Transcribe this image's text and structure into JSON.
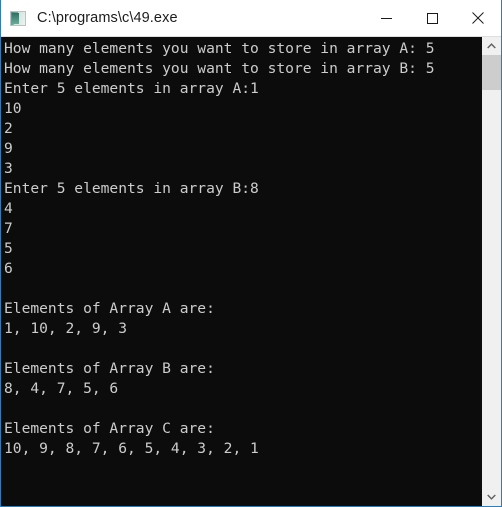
{
  "window": {
    "title": "C:\\programs\\c\\49.exe",
    "icon": "console-app-icon",
    "border_color": "#2e7cb8",
    "controls": [
      {
        "name": "minimize-button",
        "label": "Minimize",
        "glyph": "minimize-icon"
      },
      {
        "name": "maximize-button",
        "label": "Maximize",
        "glyph": "maximize-icon"
      },
      {
        "name": "close-button",
        "label": "Close",
        "glyph": "close-icon"
      }
    ]
  },
  "console": {
    "background_color": "#0c0c0c",
    "text_color": "#cccccc",
    "lines": [
      "How many elements you want to store in array A: 5",
      "How many elements you want to store in array B: 5",
      "Enter 5 elements in array A:1",
      "10",
      "2",
      "9",
      "3",
      "Enter 5 elements in array B:8",
      "4",
      "7",
      "5",
      "6",
      "",
      "Elements of Array A are:",
      "1, 10, 2, 9, 3",
      "",
      "Elements of Array B are:",
      "8, 4, 7, 5, 6",
      "",
      "Elements of Array C are:",
      "10, 9, 8, 7, 6, 5, 4, 3, 2, 1"
    ],
    "text": "How many elements you want to store in array A: 5\nHow many elements you want to store in array B: 5\nEnter 5 elements in array A:1\n10\n2\n9\n3\nEnter 5 elements in array B:8\n4\n7\n5\n6\n\nElements of Array A are:\n1, 10, 2, 9, 3\n\nElements of Array B are:\n8, 4, 7, 5, 6\n\nElements of Array C are:\n10, 9, 8, 7, 6, 5, 4, 3, 2, 1"
  },
  "scrollbar": {
    "up_arrow": "chevron-up-icon",
    "down_arrow": "chevron-down-icon",
    "thumb_color": "#cdcdcd",
    "track_color": "#f0f0f0"
  }
}
